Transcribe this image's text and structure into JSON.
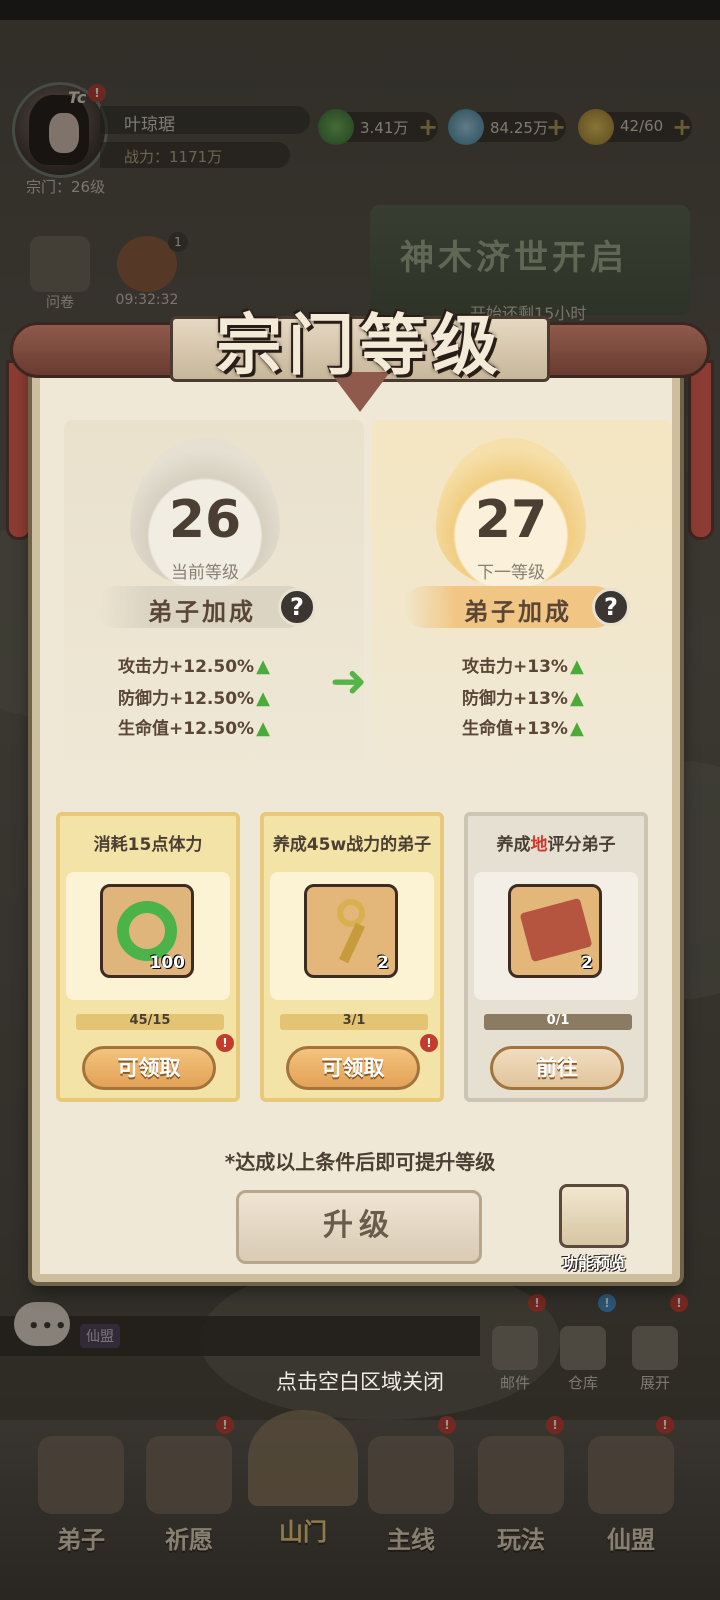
{
  "hud": {
    "player_name": "叶琼琚",
    "power": "战力：1171万",
    "sect_level": "宗门：26级",
    "vip_label": "Tc",
    "alert": "!",
    "resources": [
      {
        "icon": "jade-coin-icon",
        "value": "3.41万"
      },
      {
        "icon": "spirit-crystal-icon",
        "value": "84.25万"
      },
      {
        "icon": "stamina-pouch-icon",
        "value": "42/60"
      }
    ],
    "survey_label": "问卷",
    "timer": "09:32:32",
    "timer_badge": "1",
    "event_title": "神木济世开启",
    "event_sub": "开始还剩15小时"
  },
  "dialog": {
    "title": "宗门等级",
    "current": {
      "level": "26",
      "caption": "当前等级"
    },
    "next": {
      "level": "27",
      "caption": "下一等级"
    },
    "bonus_title": "弟子加成",
    "help": "?",
    "current_stats": [
      "攻击力+12.50%",
      "防御力+12.50%",
      "生命值+12.50%"
    ],
    "next_stats": [
      "攻击力+13%",
      "防御力+13%",
      "生命值+13%"
    ],
    "cards": [
      {
        "caption": "消耗15点体力",
        "count": "100",
        "progress": "45/15",
        "progress_value": 1.0,
        "button": "可领取",
        "item": "jade-dragon-icon"
      },
      {
        "caption_pre": "养成45w战力的弟子",
        "count": "2",
        "progress": "3/1",
        "progress_value": 1.0,
        "button": "可领取",
        "item": "golden-key-icon"
      },
      {
        "caption_pre": "养成",
        "caption_red": "地",
        "caption_post": "评分弟子",
        "count": "2",
        "progress": "0/1",
        "progress_value": 0.0,
        "button": "前往",
        "item": "red-scroll-icon"
      }
    ],
    "hint": "*达成以上条件后即可提升等级",
    "upgrade_button": "升级",
    "preview_label": "功能预览"
  },
  "footer": {
    "chat_channel": "仙盟",
    "close_hint": "点击空白区域关闭",
    "mini_buttons": [
      "邮件",
      "仓库",
      "展开"
    ],
    "nav": [
      "弟子",
      "祈愿",
      "山门",
      "主线",
      "玩法",
      "仙盟"
    ]
  }
}
